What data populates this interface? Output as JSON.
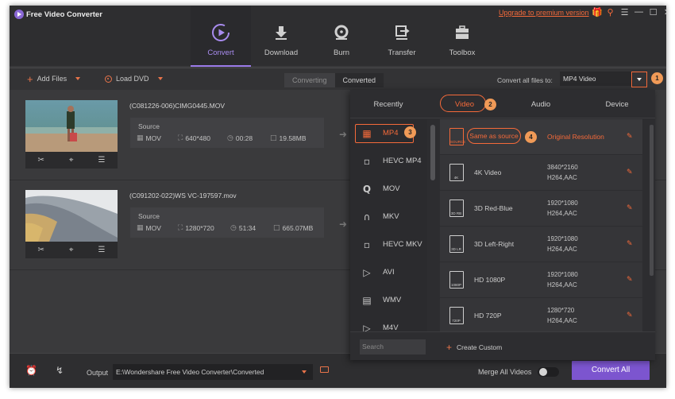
{
  "app": {
    "title": "Free Video Converter",
    "upgrade_link": "Upgrade to premium version"
  },
  "nav": [
    {
      "label": "Convert",
      "icon": "convert-icon",
      "active": true
    },
    {
      "label": "Download",
      "icon": "download-icon",
      "active": false
    },
    {
      "label": "Burn",
      "icon": "burn-icon",
      "active": false
    },
    {
      "label": "Transfer",
      "icon": "transfer-icon",
      "active": false
    },
    {
      "label": "Toolbox",
      "icon": "toolbox-icon",
      "active": false
    }
  ],
  "toolbar": {
    "add_files": "Add Files",
    "load_dvd": "Load DVD",
    "tab_converting": "Converting",
    "tab_converted": "Converted",
    "convert_all_label": "Convert all files to:",
    "format_value": "MP4 Video"
  },
  "files": [
    {
      "name": "(C081226-006)CIMG0445.MOV",
      "source_label": "Source",
      "format": "MOV",
      "resolution": "640*480",
      "duration": "00:28",
      "size": "19.58MB"
    },
    {
      "name": "(C091202-022)WS VC-197597.mov",
      "source_label": "Source",
      "format": "MOV",
      "resolution": "1280*720",
      "duration": "51:34",
      "size": "665.07MB"
    }
  ],
  "panel": {
    "tabs": [
      "Recently",
      "Video",
      "Audio",
      "Device"
    ],
    "formats": [
      {
        "label": "MP4",
        "icon": "film-icon"
      },
      {
        "label": "HEVC MP4",
        "icon": "hevc-icon"
      },
      {
        "label": "MOV",
        "icon": "quicktime-icon"
      },
      {
        "label": "MKV",
        "icon": "mkv-icon"
      },
      {
        "label": "HEVC MKV",
        "icon": "hevc-icon"
      },
      {
        "label": "AVI",
        "icon": "play-circle-icon"
      },
      {
        "label": "WMV",
        "icon": "wmv-icon"
      },
      {
        "label": "M4V",
        "icon": "m4v-icon"
      }
    ],
    "resolutions": [
      {
        "name": "Same as source",
        "spec1": "Original Resolution",
        "spec2": "",
        "badge": "SOURCE"
      },
      {
        "name": "4K Video",
        "spec1": "3840*2160",
        "spec2": "H264,AAC",
        "badge": "4K"
      },
      {
        "name": "3D Red-Blue",
        "spec1": "1920*1080",
        "spec2": "H264,AAC",
        "badge": "3D RB"
      },
      {
        "name": "3D Left-Right",
        "spec1": "1920*1080",
        "spec2": "H264,AAC",
        "badge": "3D LR"
      },
      {
        "name": "HD 1080P",
        "spec1": "1920*1080",
        "spec2": "H264,AAC",
        "badge": "1080P"
      },
      {
        "name": "HD 720P",
        "spec1": "1280*720",
        "spec2": "H264,AAC",
        "badge": "720P"
      }
    ],
    "search_placeholder": "Search",
    "create_custom": "Create Custom"
  },
  "bottom": {
    "output_label": "Output",
    "output_path": "E:\\Wondershare Free Video Converter\\Converted",
    "merge_label": "Merge All Videos",
    "convert_all": "Convert All"
  },
  "badges": [
    "1",
    "2",
    "3",
    "4"
  ],
  "colors": {
    "accent": "#f56a3a",
    "purple": "#7c55cf",
    "badge": "#f09a57"
  }
}
